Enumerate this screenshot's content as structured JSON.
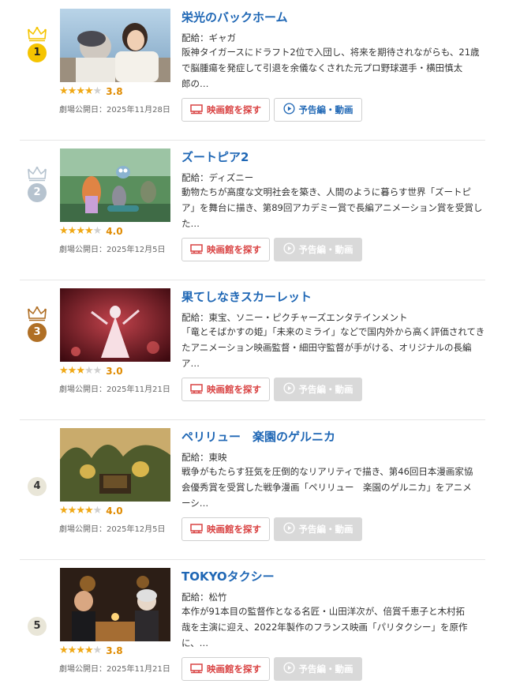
{
  "labels": {
    "distributor_prefix": "配給：",
    "release_prefix": "劇場公開日：",
    "theater_button": "映画館を探す",
    "trailer_button": "予告編・動画"
  },
  "colors": {
    "gold": "#f5c400",
    "silver": "#b6c3cf",
    "bronze": "#b06f25",
    "plain": "#e9e6d8",
    "star": "#f0a916",
    "title": "#1f67b5",
    "theater_text": "#d94242"
  },
  "movies": [
    {
      "rank": "1",
      "rank_style": "gold",
      "title": "栄光のバックホーム",
      "distributor": "ギャガ",
      "description": "阪神タイガースにドラフト2位で入団し、将来を期待されながらも、21歳\nで脳腫瘍を発症して引退を余儀なくされた元プロ野球選手・横田慎太\n郎の…",
      "stars": 3.5,
      "score": "3.8",
      "release_date": "2025年11月28日",
      "trailer_enabled": true,
      "image": "baseball-player-and-woman-photo"
    },
    {
      "rank": "2",
      "rank_style": "silver",
      "title": "ズートピア2",
      "distributor": "ディズニー",
      "description": "動物たちが高度な文明社会を築き、人間のように暮らす世界「ズートピ\nア」を舞台に描き、第89回アカデミー賞で長編アニメーション賞を受賞し\nた…",
      "stars": 4,
      "score": "4.0",
      "release_date": "2025年12月5日",
      "trailer_enabled": false,
      "image": "animated-animals-photo"
    },
    {
      "rank": "3",
      "rank_style": "bronze",
      "title": "果てしなきスカーレット",
      "distributor": "東宝、ソニー・ピクチャーズエンタテインメント",
      "description": "「竜とそばかすの姫」「未来のミライ」などで国内外から高く評価されてき\nたアニメーション映画監督・細田守監督が手がける、オリジナルの長編\nア…",
      "stars": 3,
      "score": "3.0",
      "release_date": "2025年11月21日",
      "trailer_enabled": false,
      "image": "scarlet-dress-figure-photo"
    },
    {
      "rank": "4",
      "rank_style": "plain",
      "title": "ペリリュー　楽園のゲルニカ",
      "distributor": "東映",
      "description": "戦争がもたらす狂気を圧倒的なリアリティで描き、第46回日本漫画家協\n会優秀賞を受賞した戦争漫画「ペリリュー　楽園のゲルニカ」をアニメ\nーシ…",
      "stars": 4,
      "score": "4.0",
      "release_date": "2025年12月5日",
      "trailer_enabled": false,
      "image": "jungle-animation-photo"
    },
    {
      "rank": "5",
      "rank_style": "plain",
      "title": "TOKYOタクシー",
      "distributor": "松竹",
      "description": "本作が91本目の監督作となる名匠・山田洋次が、倍賞千恵子と木村拓\n哉を主演に迎え、2022年製作のフランス映画「パリタクシー」を原作\nに、…",
      "stars": 3.5,
      "score": "3.8",
      "release_date": "2025年11月21日",
      "trailer_enabled": false,
      "image": "restaurant-dinner-photo"
    }
  ]
}
